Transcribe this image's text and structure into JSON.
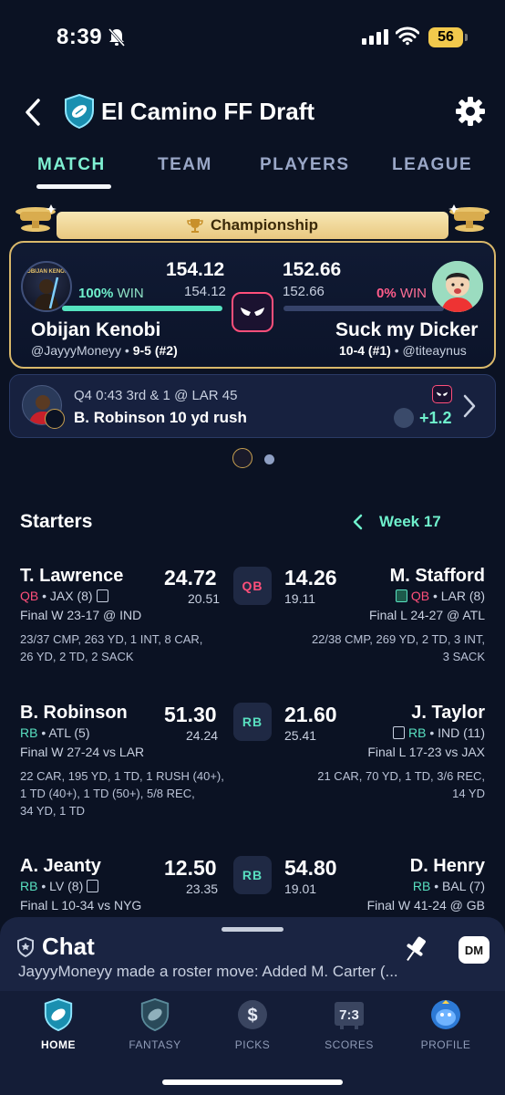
{
  "status": {
    "time": "8:39",
    "battery": "56"
  },
  "header": {
    "title": "El Camino FF Draft"
  },
  "tabs": [
    {
      "label": "MATCH"
    },
    {
      "label": "TEAM"
    },
    {
      "label": "PLAYERS"
    },
    {
      "label": "LEAGUE"
    }
  ],
  "matchup": {
    "banner": "Championship",
    "left": {
      "score": "154.12",
      "projected": "154.12",
      "win_pct": "100%",
      "win_word": "WIN",
      "team": "Obijan Kenobi",
      "handle": "@JayyyMoneyy",
      "record": "9-5 (#2)",
      "avatar_text": "OBIJAN KENOBI",
      "win_bar_fraction": 1.0
    },
    "right": {
      "score": "152.66",
      "projected": "152.66",
      "win_pct": "0%",
      "win_word": "WIN",
      "team": "Suck my Dicker",
      "handle": "@titeaynus",
      "record": "10-4 (#1)",
      "win_bar_fraction": 0.0
    }
  },
  "live_play": {
    "situation": "Q4 0:43 3rd & 1 @ LAR 45",
    "description": "B. Robinson 10 yd rush",
    "points": "+1.2"
  },
  "starters": {
    "title": "Starters",
    "week": "Week 17",
    "rows": [
      {
        "position": "QB",
        "left": {
          "name": "T. Lawrence",
          "pos": "QB",
          "team": "JAX (8)",
          "score": "24.72",
          "proj": "20.51",
          "game": "Final W 23-17 @ IND",
          "stats_1": "23/37 CMP, 263 YD, 1 INT, 8 CAR,",
          "stats_2": "26 YD, 2 TD, 2 SACK"
        },
        "right": {
          "name": "M. Stafford",
          "pos": "QB",
          "team": "LAR (8)",
          "score": "14.26",
          "proj": "19.11",
          "game": "Final L 24-27 @ ATL",
          "stats_1": "22/38 CMP, 269 YD, 2 TD, 3 INT,",
          "stats_2": "3 SACK"
        }
      },
      {
        "position": "RB",
        "left": {
          "name": "B. Robinson",
          "pos": "RB",
          "team": "ATL (5)",
          "score": "51.30",
          "proj": "24.24",
          "game": "Final W 27-24 vs LAR",
          "stats_1": "22 CAR, 195 YD, 1 TD, 1 RUSH (40+),",
          "stats_2": "1 TD (40+), 1 TD (50+), 5/8 REC,",
          "stats_3": "34 YD, 1 TD"
        },
        "right": {
          "name": "J. Taylor",
          "pos": "RB",
          "team": "IND (11)",
          "score": "21.60",
          "proj": "25.41",
          "game": "Final L 17-23 vs JAX",
          "stats_1": "21 CAR, 70 YD, 1 TD, 3/6 REC,",
          "stats_2": "14 YD"
        }
      },
      {
        "position": "RB",
        "left": {
          "name": "A. Jeanty",
          "pos": "RB",
          "team": "LV (8)",
          "score": "12.50",
          "proj": "23.35",
          "game": "Final L 10-34 vs NYG"
        },
        "right": {
          "name": "D. Henry",
          "pos": "RB",
          "team": "BAL (7)",
          "score": "54.80",
          "proj": "19.01",
          "game": "Final W 41-24 @ GB"
        }
      }
    ]
  },
  "chat": {
    "title": "Chat",
    "dm_label": "DM",
    "message": "JayyyMoneyy made a roster move: Added M. Carter (..."
  },
  "bottom_nav": [
    {
      "label": "HOME",
      "icon": "home-football-shield-icon"
    },
    {
      "label": "FANTASY",
      "icon": "fantasy-shield-icon"
    },
    {
      "label": "PICKS",
      "icon": "dollar-coin-icon"
    },
    {
      "label": "SCORES",
      "icon": "scoreboard-icon"
    },
    {
      "label": "PROFILE",
      "icon": "profile-mascot-icon"
    }
  ],
  "colors": {
    "accent": "#6ff0cc",
    "loss": "#ff4f7a",
    "gold": "#d9b86a",
    "background": "#0b1223"
  }
}
